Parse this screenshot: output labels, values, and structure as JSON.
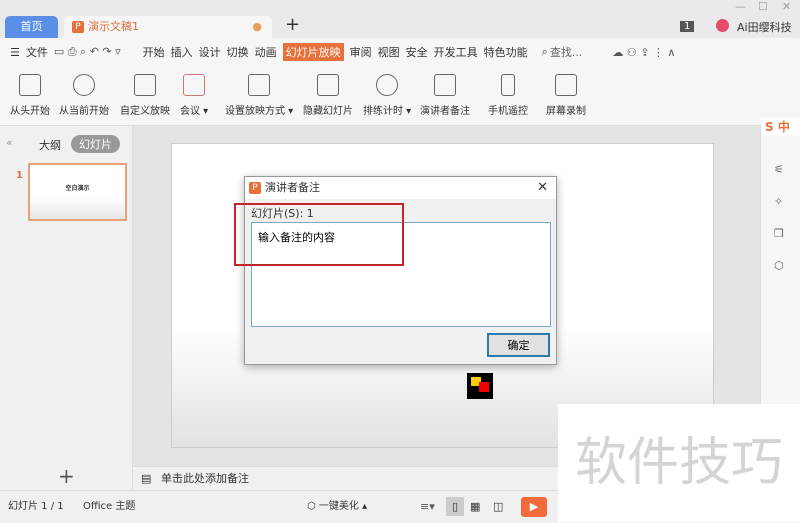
{
  "tabs": {
    "home": "首页",
    "doc": "演示文稿1",
    "badge": "1",
    "user": "Ai田缨科技"
  },
  "menu": {
    "file": "文件",
    "items": [
      "开始",
      "插入",
      "设计",
      "切换",
      "动画",
      "幻灯片放映",
      "审阅",
      "视图",
      "安全",
      "开发工具",
      "特色功能"
    ],
    "active": "幻灯片放映",
    "search": "查找..."
  },
  "ribbon": [
    "从头开始",
    "从当前开始",
    "自定义放映",
    "会议",
    "设置放映方式",
    "隐藏幻灯片",
    "排练计时",
    "演讲者备注",
    "手机遥控",
    "屏幕录制"
  ],
  "left": {
    "outline": "大纲",
    "slides": "幻灯片",
    "num": "1",
    "thumb_title": "空白演示"
  },
  "notes": "单击此处添加备注",
  "status": {
    "slide": "幻灯片 1 / 1",
    "theme": "Office 主题",
    "beautify": "一键美化"
  },
  "dialog": {
    "title": "演讲者备注",
    "label": "幻灯片(S): 1",
    "text": "输入备注的内容",
    "ok": "确定"
  },
  "watermark": "软件技巧",
  "colors": {
    "accent": "#e8703a",
    "home_tab": "#5b8ee6",
    "highlight": "#c0262c"
  }
}
